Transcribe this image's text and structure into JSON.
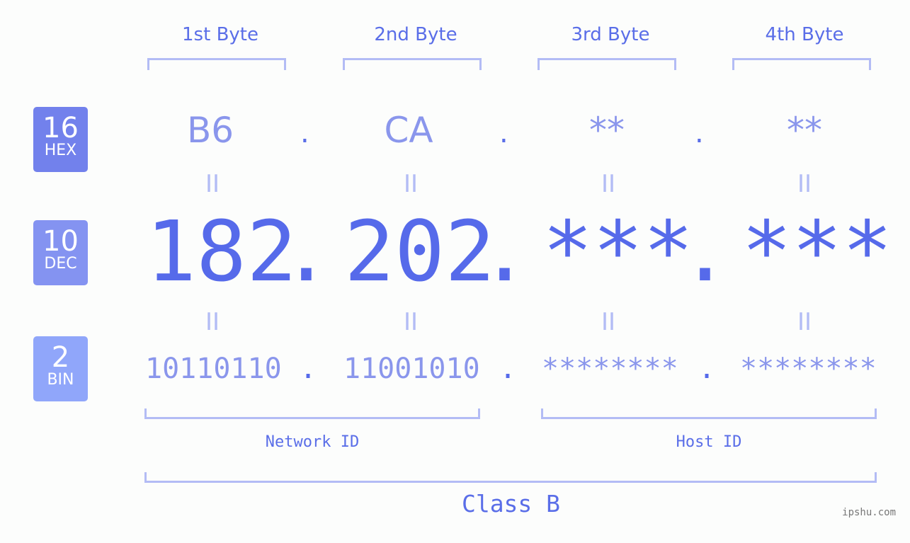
{
  "bytes": {
    "labels": [
      "1st Byte",
      "2nd Byte",
      "3rd Byte",
      "4th Byte"
    ]
  },
  "badges": [
    {
      "num": "16",
      "label": "HEX",
      "color": "#7281ec"
    },
    {
      "num": "10",
      "label": "DEC",
      "color": "#8493f1"
    },
    {
      "num": "2",
      "label": "BIN",
      "color": "#90a6fa"
    }
  ],
  "hex": [
    "B6",
    "CA",
    "**",
    "**"
  ],
  "dec": [
    "182",
    "202",
    "***",
    "***"
  ],
  "bin": [
    "10110110",
    "11001010",
    "********",
    "********"
  ],
  "separator": ".",
  "equals": "II",
  "network_id_label": "Network ID",
  "host_id_label": "Host ID",
  "class_label": "Class B",
  "watermark": "ipshu.com"
}
